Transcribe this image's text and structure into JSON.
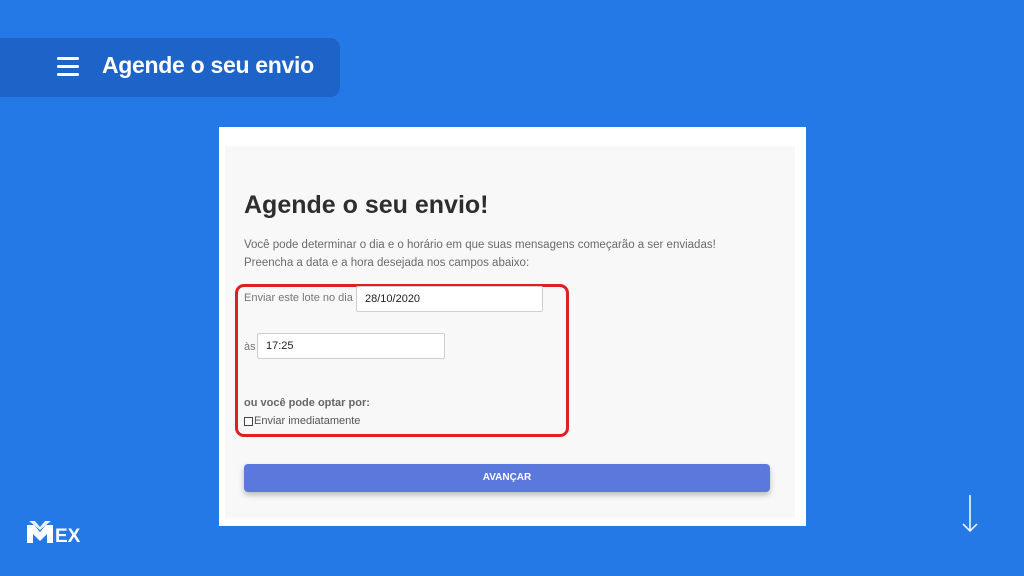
{
  "header": {
    "title": "Agende o seu envio",
    "menu_icon": "hamburger-menu-icon"
  },
  "form": {
    "title": "Agende o seu envio!",
    "description": "Você pode determinar o dia e o horário em que suas mensagens começarão a ser enviadas! Preencha a data e a hora desejada nos campos abaixo:",
    "date_label": "Enviar este lote no dia",
    "date_value": "28/10/2020",
    "time_label": "às",
    "time_value": "17:25",
    "or_label": "ou você pode optar por:",
    "checkbox_label": "Enviar imediatamente",
    "checkbox_checked": false,
    "submit_label": "AVANÇAR"
  },
  "footer": {
    "logo_text": "MEX",
    "arrow_icon": "arrow-down-icon"
  },
  "colors": {
    "background": "#2479e6",
    "button": "#5b79dd",
    "highlight": "#e02020"
  }
}
